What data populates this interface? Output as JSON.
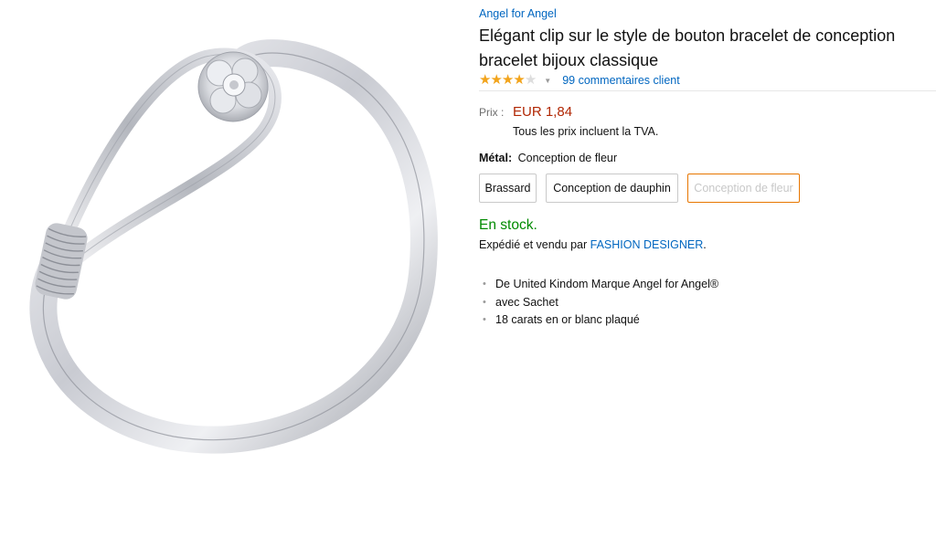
{
  "brand": {
    "link_text": "Angel for Angel"
  },
  "product": {
    "title": "Elégant clip sur le style de bouton bracelet de conception bracelet bijoux classique",
    "image_alt": "bracelet"
  },
  "rating": {
    "stars_out_of_5": 4,
    "reviews_link": "99 commentaires client"
  },
  "price": {
    "label": "Prix :",
    "value": "EUR 1,84",
    "vat_note": "Tous les prix incluent la TVA."
  },
  "variant": {
    "label": "Métal:",
    "selected": "Conception de fleur",
    "options": [
      "Brassard",
      "Conception de dauphin",
      "Conception de fleur"
    ]
  },
  "availability": {
    "status": "En stock.",
    "shipped_prefix": "Expédié et vendu par ",
    "seller": "FASHION DESIGNER",
    "shipped_suffix": "."
  },
  "features": [
    "De United Kindom Marque Angel for Angel®",
    "avec Sachet",
    "18 carats en or blanc plaqué"
  ],
  "colors": {
    "link": "#0066c0",
    "price": "#b12704",
    "in_stock": "#008a00",
    "star": "#f2a41c",
    "selected_border": "#e77600"
  }
}
